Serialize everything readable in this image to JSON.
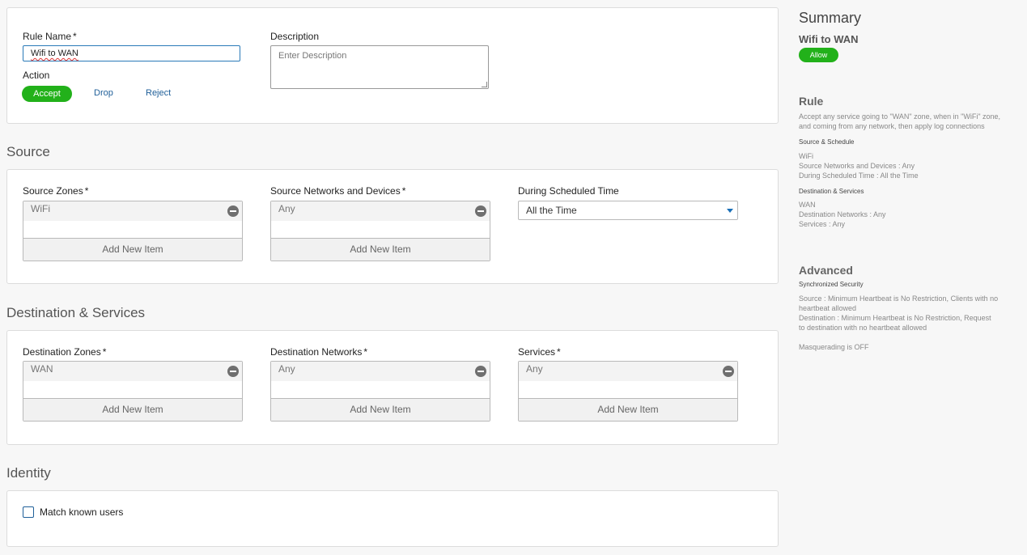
{
  "rule": {
    "name_label": "Rule Name",
    "name_value": "Wifi to WAN",
    "description_label": "Description",
    "description_placeholder": "Enter Description",
    "action_label": "Action",
    "actions": [
      "Accept",
      "Drop",
      "Reject"
    ],
    "selected_action": "Accept"
  },
  "source": {
    "title": "Source",
    "zones_label": "Source Zones",
    "zones": [
      "WiFi"
    ],
    "networks_label": "Source Networks and Devices",
    "networks": [
      "Any"
    ],
    "schedule_label": "During Scheduled Time",
    "schedule_value": "All the Time",
    "add_label": "Add New Item"
  },
  "destination": {
    "title": "Destination & Services",
    "zones_label": "Destination Zones",
    "zones": [
      "WAN"
    ],
    "networks_label": "Destination Networks",
    "networks": [
      "Any"
    ],
    "services_label": "Services",
    "services": [
      "Any"
    ],
    "add_label": "Add New Item"
  },
  "identity": {
    "title": "Identity",
    "match_label": "Match known users",
    "match_checked": false
  },
  "required_mark": "*",
  "summary": {
    "title": "Summary",
    "rule_name": "Wifi to WAN",
    "badge": "Allow",
    "rule_heading": "Rule",
    "rule_desc_1": "Accept any service going to \"WAN\" zone, when in \"WiFi\" zone,",
    "rule_desc_2": "and coming from any network, then apply log connections",
    "source_schedule_heading": "Source & Schedule",
    "source_lines": [
      "WiFi",
      "Source Networks and Devices : Any",
      "During Scheduled Time : All the Time"
    ],
    "dest_services_heading": "Destination & Services",
    "dest_lines": [
      "WAN",
      "Destination Networks : Any",
      "Services : Any"
    ],
    "advanced_heading": "Advanced",
    "sync_heading": "Synchronized Security",
    "sync_lines": [
      "Source : Minimum Heartbeat is No Restriction, Clients with no",
      "heartbeat allowed",
      "Destination : Minimum Heartbeat is No Restriction, Request",
      "to destination with no heartbeat allowed"
    ],
    "masquerading": "Masquerading is OFF"
  },
  "colors": {
    "accent_green": "#22b11a",
    "link_blue": "#1f5f99",
    "input_border_focus": "#2a7ab8"
  }
}
